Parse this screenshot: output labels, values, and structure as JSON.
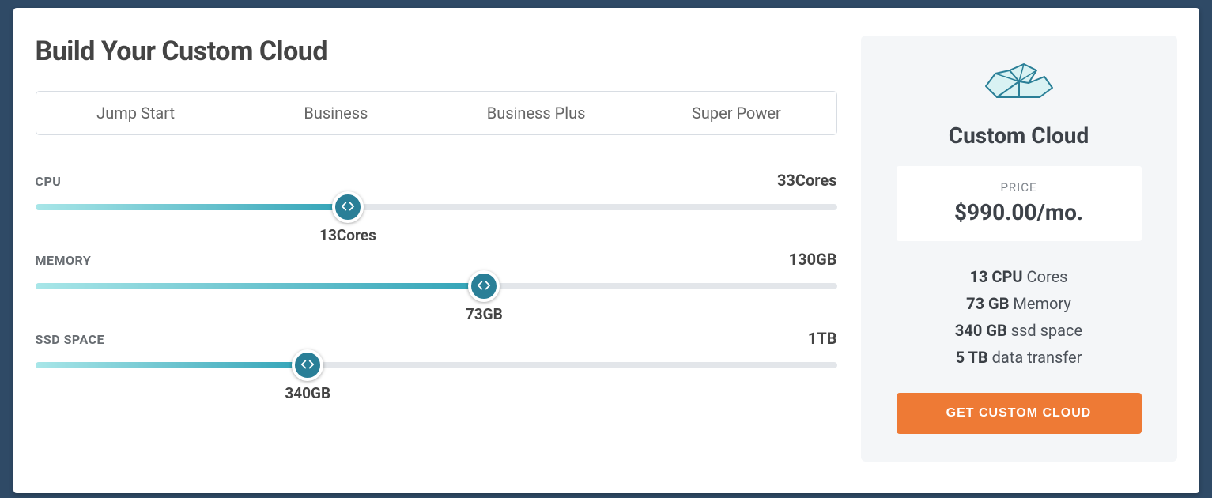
{
  "title": "Build Your Custom Cloud",
  "tabs": [
    {
      "label": "Jump Start"
    },
    {
      "label": "Business"
    },
    {
      "label": "Business Plus"
    },
    {
      "label": "Super Power"
    }
  ],
  "sliders": {
    "cpu": {
      "label": "CPU",
      "max_label": "33Cores",
      "value_label": "13Cores",
      "percent": 39
    },
    "memory": {
      "label": "MEMORY",
      "max_label": "130GB",
      "value_label": "73GB",
      "percent": 56
    },
    "ssd": {
      "label": "SSD SPACE",
      "max_label": "1TB",
      "value_label": "340GB",
      "percent": 34
    }
  },
  "summary": {
    "title": "Custom Cloud",
    "price_label": "PRICE",
    "price_value": "$990.00/mo.",
    "specs": [
      {
        "strong": "13 CPU",
        "rest": " Cores"
      },
      {
        "strong": "73 GB",
        "rest": " Memory"
      },
      {
        "strong": "340 GB",
        "rest": " ssd space"
      },
      {
        "strong": "5 TB",
        "rest": " data transfer"
      }
    ],
    "cta_label": "GET CUSTOM CLOUD"
  },
  "colors": {
    "accent": "#2a7f97",
    "cta": "#ee7a35"
  }
}
